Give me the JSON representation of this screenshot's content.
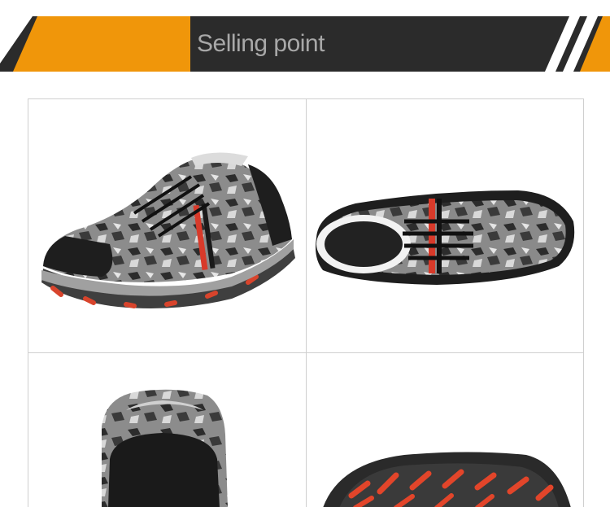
{
  "header": {
    "title": "Selling point",
    "colors": {
      "bar": "#2b2b2b",
      "accent": "#f0960a",
      "text": "#a8a8a8"
    }
  },
  "gallery": {
    "images": [
      {
        "name": "shoe-side-view"
      },
      {
        "name": "shoe-top-view"
      },
      {
        "name": "shoe-heel-view"
      },
      {
        "name": "shoe-sole-view"
      }
    ]
  }
}
